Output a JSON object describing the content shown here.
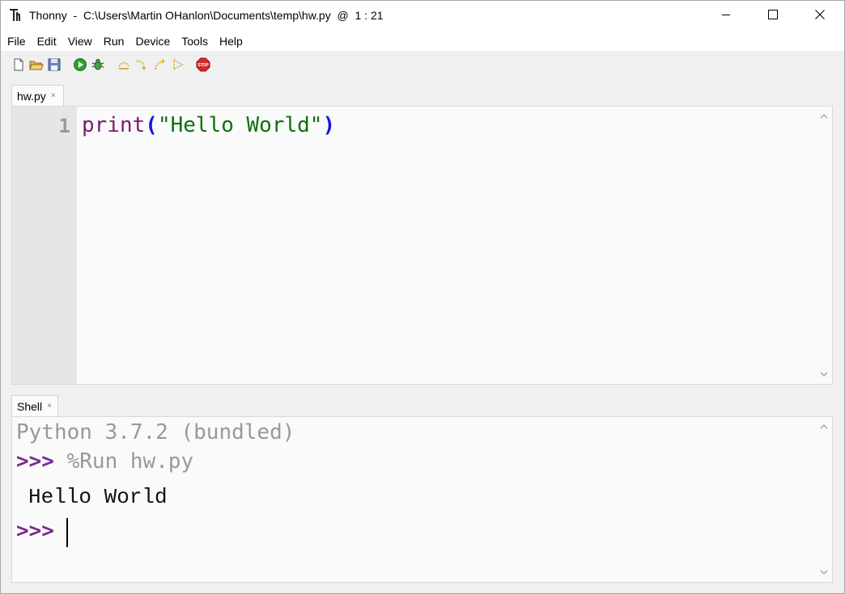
{
  "window": {
    "app_name": "Thonny",
    "title_sep": "-",
    "file_path": "C:\\Users\\Martin OHanlon\\Documents\\temp\\hw.py",
    "at": "@",
    "cursor_pos": "1 : 21"
  },
  "window_controls": {
    "minimize_icon": "minimize-icon",
    "maximize_icon": "maximize-icon",
    "close_icon": "close-icon"
  },
  "menu": [
    "File",
    "Edit",
    "View",
    "Run",
    "Device",
    "Tools",
    "Help"
  ],
  "toolbar": {
    "icons": [
      "new-file-icon",
      "open-file-icon",
      "save-icon",
      "run-icon",
      "debug-icon",
      "step-over-icon",
      "step-into-icon",
      "step-out-icon",
      "resume-icon",
      "stop-icon"
    ],
    "stop_label": "STOP"
  },
  "editor": {
    "tab_label": "hw.py",
    "tab_close": "×",
    "line_number": "1",
    "code": {
      "func": "print",
      "lparen": "(",
      "string": "\"Hello World\"",
      "rparen": ")"
    },
    "colors": {
      "func": "#7b1b6f",
      "paren": "#1515e0",
      "string": "#0f6f0f"
    }
  },
  "shell": {
    "tab_label": "Shell",
    "tab_close": "×",
    "banner": "Python 3.7.2 (bundled)",
    "prompt": ">>>",
    "command": "%Run hw.py",
    "output": "Hello World",
    "colors": {
      "prompt": "#7b2a8f",
      "muted": "#999999"
    }
  }
}
